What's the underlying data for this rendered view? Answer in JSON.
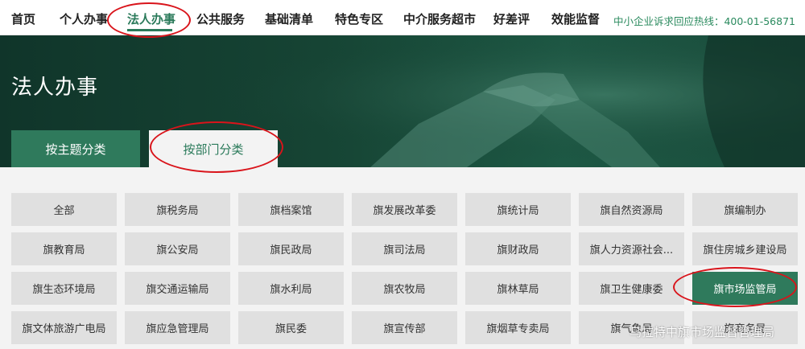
{
  "nav": {
    "items": [
      {
        "label": "首页"
      },
      {
        "label": "个人办事"
      },
      {
        "label": "法人办事",
        "active": true
      },
      {
        "label": "公共服务"
      },
      {
        "label": "基础清单"
      },
      {
        "label": "特色专区"
      },
      {
        "label": "中介服务超市"
      },
      {
        "label": "好差评"
      },
      {
        "label": "效能监督"
      }
    ],
    "hotline": "中小企业诉求回应热线：400-01-56871"
  },
  "banner": {
    "title": "法人办事"
  },
  "tabs": [
    {
      "label": "按主题分类",
      "active": false
    },
    {
      "label": "按部门分类",
      "active": true
    }
  ],
  "departments": [
    [
      "全部",
      "旗税务局",
      "旗档案馆",
      "旗发展改革委",
      "旗统计局",
      "旗自然资源局",
      "旗编制办"
    ],
    [
      "旗教育局",
      "旗公安局",
      "旗民政局",
      "旗司法局",
      "旗财政局",
      "旗人力资源社会...",
      "旗住房城乡建设局"
    ],
    [
      "旗生态环境局",
      "旗交通运输局",
      "旗水利局",
      "旗农牧局",
      "旗林草局",
      "旗卫生健康委",
      "旗市场监管局"
    ],
    [
      "旗文体旅游广电局",
      "旗应急管理局",
      "旗民委",
      "旗宣传部",
      "旗烟草专卖局",
      "旗气象局",
      "旗商务局"
    ]
  ],
  "selected_department": "旗市场监管局",
  "watermark": "乌拉特中旗市场监督管理局",
  "colors": {
    "accent": "#2f7a5c",
    "annotation": "#d9141b",
    "banner": "#164434"
  }
}
